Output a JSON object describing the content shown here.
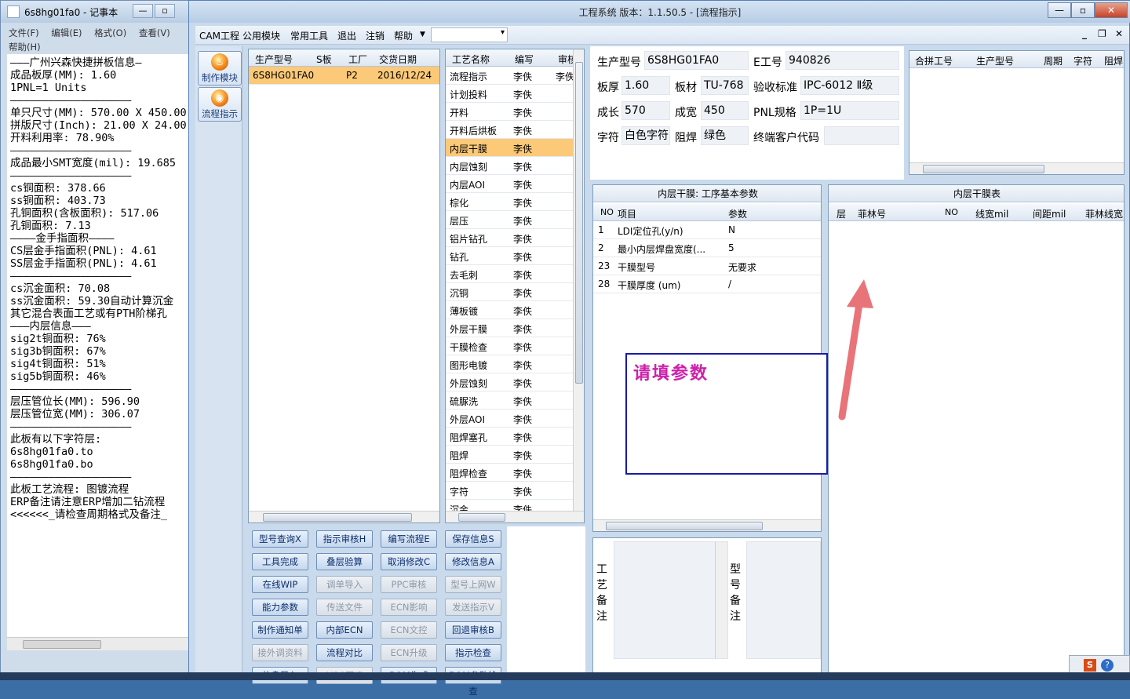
{
  "notepad": {
    "title": "6s8hg01fa0 - 记事本",
    "menu": [
      "文件(F)",
      "编辑(E)",
      "格式(O)",
      "查看(V)",
      "帮助(H)"
    ],
    "lines": [
      "———广州兴森快捷拼板信息—",
      "成品板厚(MM): 1.60",
      "1PNL=1 Units",
      "———————————————————",
      "单只尺寸(MM): 570.00 X 450.00",
      "拼版尺寸(Inch): 21.00 X 24.00",
      "开料利用率: 78.90%",
      "———————————————————",
      "成品最小SMT宽度(mil): 19.685",
      "———————————————————",
      "cs铜面积: 378.66",
      "ss铜面积: 403.73",
      "孔铜面积(含板面积): 517.06",
      "孔铜面积: 7.13",
      "————金手指面积————",
      "CS层金手指面积(PNL): 4.61",
      "SS层金手指面积(PNL): 4.61",
      "———————————————————",
      "cs沉金面积: 70.08",
      "ss沉金面积: 59.30自动计算沉金",
      "其它混合表面工艺或有PTH阶梯孔",
      "———内层信息———",
      "sig2t铜面积: 76%",
      "sig3b铜面积: 67%",
      "sig4t铜面积: 51%",
      "sig5b铜面积: 46%",
      "———————————————————",
      "层压管位长(MM): 596.90",
      "层压管位宽(MM): 306.07",
      "———————————————————",
      "此板有以下字符层:",
      "6s8hg01fa0.to",
      "6s8hg01fa0.bo",
      "———————————————————",
      "此板工艺流程: 图镀流程",
      "ERP备注请注意ERP增加二钻流程",
      "<<<<<<_请检查周期格式及备注_"
    ]
  },
  "app": {
    "title": "工程系统   版本：1.1.50.5 - [流程指示]",
    "menu": [
      "CAM工程",
      "公用模块",
      "常用工具",
      "退出",
      "注销",
      "帮助"
    ],
    "nav": [
      {
        "label": "制作模块",
        "icon": "flame-icon"
      },
      {
        "label": "流程指示",
        "icon": "flow-icon"
      }
    ],
    "orders": {
      "headers": [
        "生产型号",
        "S板",
        "工厂",
        "交货日期"
      ],
      "rows": [
        {
          "model": "6S8HG01FA0",
          "s": "",
          "factory": "P2",
          "date": "2016/12/24"
        }
      ]
    },
    "process": {
      "headers": [
        "工艺名称",
        "编写",
        "审核"
      ],
      "rows": [
        {
          "name": "流程指示",
          "writer": "李佚",
          "audit": "李佚"
        },
        {
          "name": "计划投料",
          "writer": "李佚",
          "audit": ""
        },
        {
          "name": "开料",
          "writer": "李佚",
          "audit": ""
        },
        {
          "name": "开料后烘板",
          "writer": "李佚",
          "audit": ""
        },
        {
          "name": "内层干膜",
          "writer": "李佚",
          "audit": ""
        },
        {
          "name": "内层蚀刻",
          "writer": "李佚",
          "audit": ""
        },
        {
          "name": "内层AOI",
          "writer": "李佚",
          "audit": ""
        },
        {
          "name": "棕化",
          "writer": "李佚",
          "audit": ""
        },
        {
          "name": "层压",
          "writer": "李佚",
          "audit": ""
        },
        {
          "name": "铝片钻孔",
          "writer": "李佚",
          "audit": ""
        },
        {
          "name": "钻孔",
          "writer": "李佚",
          "audit": ""
        },
        {
          "name": "去毛刺",
          "writer": "李佚",
          "audit": ""
        },
        {
          "name": "沉铜",
          "writer": "李佚",
          "audit": ""
        },
        {
          "name": "薄板镀",
          "writer": "李佚",
          "audit": ""
        },
        {
          "name": "外层干膜",
          "writer": "李佚",
          "audit": ""
        },
        {
          "name": "干膜检查",
          "writer": "李佚",
          "audit": ""
        },
        {
          "name": "图形电镀",
          "writer": "李佚",
          "audit": ""
        },
        {
          "name": "外层蚀刻",
          "writer": "李佚",
          "audit": ""
        },
        {
          "name": "硫脲洗",
          "writer": "李佚",
          "audit": ""
        },
        {
          "name": "外层AOI",
          "writer": "李佚",
          "audit": ""
        },
        {
          "name": "阻焊塞孔",
          "writer": "李佚",
          "audit": ""
        },
        {
          "name": "阻焊",
          "writer": "李佚",
          "audit": ""
        },
        {
          "name": "阻焊检查",
          "writer": "李佚",
          "audit": ""
        },
        {
          "name": "字符",
          "writer": "李佚",
          "audit": ""
        },
        {
          "name": "沉金",
          "writer": "李佚",
          "audit": ""
        }
      ],
      "selected_index": 4
    },
    "buttons": [
      [
        {
          "label": "型号查询X",
          "enabled": true
        },
        {
          "label": "指示审核H",
          "enabled": true
        },
        {
          "label": "编写流程E",
          "enabled": true
        },
        {
          "label": "保存信息S",
          "enabled": true
        }
      ],
      [
        {
          "label": "工具完成",
          "enabled": true
        },
        {
          "label": "叠层验算",
          "enabled": true
        },
        {
          "label": "取消修改C",
          "enabled": true
        },
        {
          "label": "修改信息A",
          "enabled": true
        }
      ],
      [
        {
          "label": "在线WIP",
          "enabled": true
        },
        {
          "label": "调单导入",
          "enabled": false
        },
        {
          "label": "PPC审核",
          "enabled": false
        },
        {
          "label": "型号上网W",
          "enabled": false
        }
      ],
      [
        {
          "label": "能力参数",
          "enabled": true
        },
        {
          "label": "传送文件",
          "enabled": false
        },
        {
          "label": "ECN影响",
          "enabled": false
        },
        {
          "label": "发送指示V",
          "enabled": false
        }
      ],
      [
        {
          "label": "制作通知单",
          "enabled": true
        },
        {
          "label": "内部ECN",
          "enabled": true
        },
        {
          "label": "ECN文控",
          "enabled": false
        },
        {
          "label": "回退审核B",
          "enabled": true
        }
      ],
      [
        {
          "label": "接外调资料",
          "enabled": false
        },
        {
          "label": "流程对比",
          "enabled": true
        },
        {
          "label": "ECN升级",
          "enabled": false
        },
        {
          "label": "指示检查",
          "enabled": true
        }
      ],
      [
        {
          "label": "信息导入",
          "enabled": true
        },
        {
          "label": "MRS同步",
          "enabled": false
        },
        {
          "label": "BOM生成",
          "enabled": true
        },
        {
          "label": "BOM参数检查",
          "enabled": true
        }
      ]
    ],
    "info": {
      "product_model_label": "生产型号",
      "product_model": "6S8HG01FA0",
      "e_no_label": "E工号",
      "e_no": "940826",
      "thickness_label": "板厚",
      "thickness": "1.60",
      "material_label": "板材",
      "material": "TU-768",
      "standard_label": "验收标准",
      "standard": "IPC-6012 Ⅱ级",
      "length_label": "成长",
      "length": "570",
      "width_label": "成宽",
      "width": "450",
      "pnl_label": "PNL规格",
      "pnl": "1P=1U",
      "char_label": "字符",
      "char": "白色字符",
      "mask_label": "阻焊",
      "mask": "绿色",
      "customer_code_label": "终端客户代码",
      "customer_code": ""
    },
    "merge": {
      "headers": [
        "合拼工号",
        "生产型号",
        "周期",
        "字符",
        "阻焊"
      ]
    },
    "params": {
      "title": "内层干膜: 工序基本参数",
      "headers": [
        "NO",
        "项目",
        "参数"
      ],
      "rows": [
        {
          "no": "1",
          "item": "LDI定位孔(y/n)",
          "value": "N"
        },
        {
          "no": "2",
          "item": "最小内层焊盘宽度(...",
          "value": "5"
        },
        {
          "no": "23",
          "item": "干膜型号",
          "value": "无要求"
        },
        {
          "no": "28",
          "item": "干膜厚度 (um)",
          "value": "/"
        }
      ]
    },
    "film_table": {
      "title": "内层干膜表",
      "headers": [
        "层",
        "菲林号",
        "NO",
        "线宽mil",
        "间距mil",
        "菲林线宽"
      ]
    },
    "remarks": {
      "process_label": "工艺备注",
      "model_label": "型号备注"
    },
    "annotation": "请填参数",
    "colors": {
      "selected_row": "#fbc977",
      "annotation_text": "#cc22aa",
      "arrow": "#e8747a"
    }
  }
}
